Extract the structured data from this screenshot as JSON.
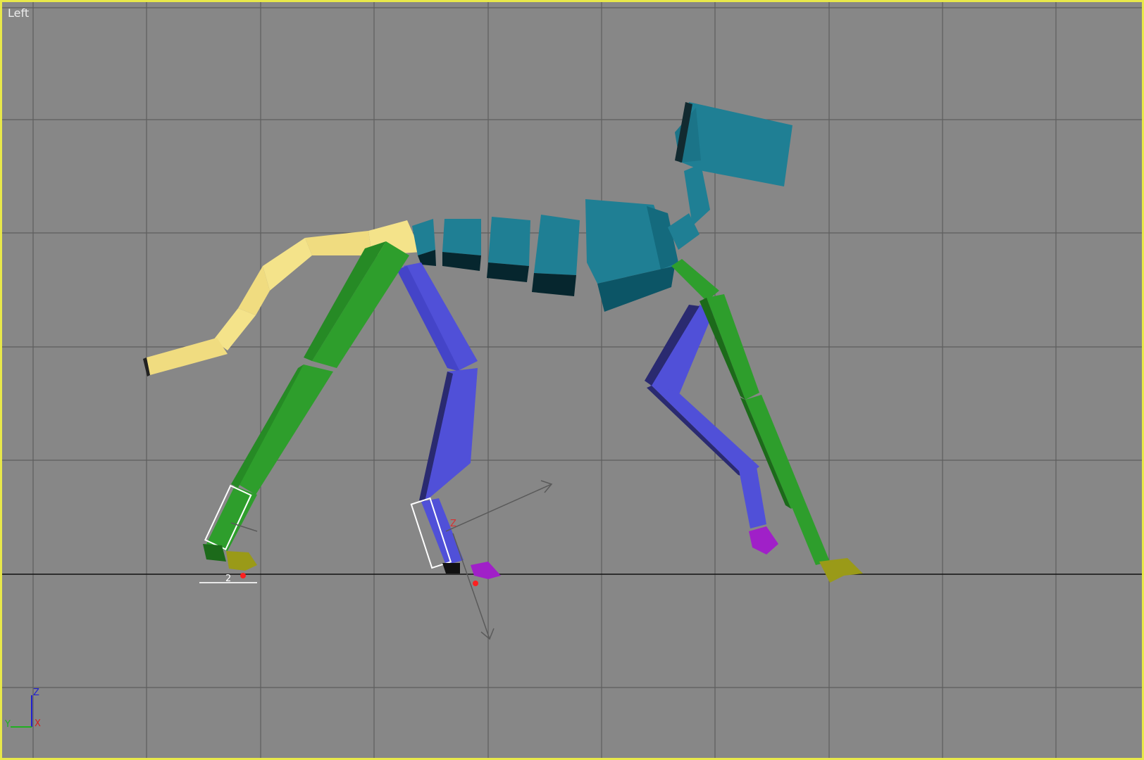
{
  "viewport": {
    "label": "Left",
    "border_color": "#e8e84a",
    "background_color": "#878787"
  },
  "rig_colors": {
    "tail": "#f4e38a",
    "spine_head": "#1f7f94",
    "left_legs": "#2e9e2c",
    "right_legs": "#5050d8",
    "feet_left": "#9a9a18",
    "feet_right": "#a020c8"
  },
  "gizmo": {
    "foot_marker_label": "2",
    "gizmo_axis_label": "Z"
  },
  "axis_tripod": {
    "z": "Z",
    "x": "X",
    "y": "Y"
  }
}
